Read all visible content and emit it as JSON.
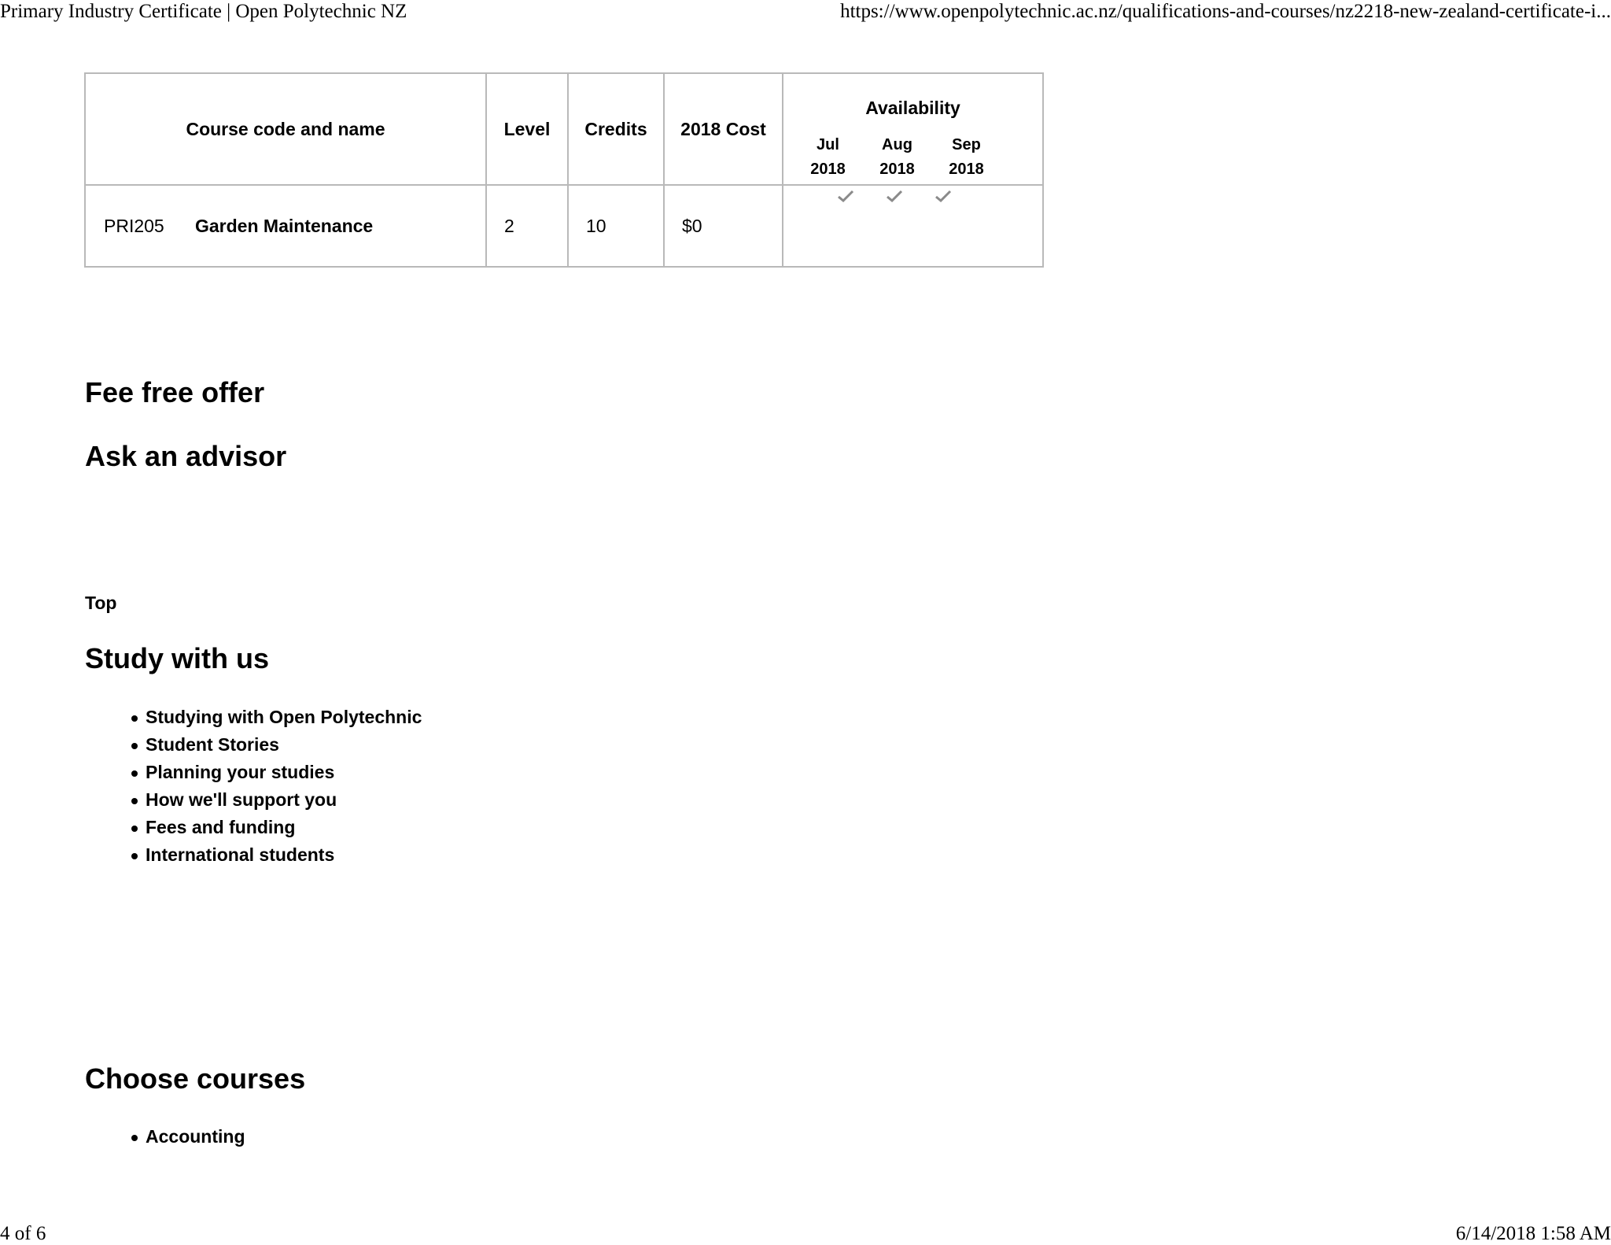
{
  "print_header": {
    "title": "Primary Industry Certificate | Open Polytechnic NZ",
    "url": "https://www.openpolytechnic.ac.nz/qualifications-and-courses/nz2218-new-zealand-certificate-i..."
  },
  "course_table": {
    "headers": {
      "name": "Course code and name",
      "level": "Level",
      "credits": "Credits",
      "cost": "2018 Cost",
      "availability": "Availability"
    },
    "months": [
      {
        "month": "Jul",
        "year": "2018"
      },
      {
        "month": "Aug",
        "year": "2018"
      },
      {
        "month": "Sep",
        "year": "2018"
      }
    ],
    "rows": [
      {
        "code": "PRI205",
        "name": "Garden Maintenance",
        "level": "2",
        "credits": "10",
        "cost": "$0",
        "available": [
          true,
          true,
          true
        ]
      }
    ]
  },
  "sections": {
    "fee_free": "Fee free offer",
    "ask_advisor": "Ask an advisor",
    "top": "Top",
    "study_with_us": "Study with us",
    "choose_courses": "Choose courses"
  },
  "study_links": [
    "Studying with Open Polytechnic",
    "Student Stories",
    "Planning your studies",
    "How we'll support you",
    "Fees and funding",
    "International students"
  ],
  "course_links": [
    "Accounting"
  ],
  "print_footer": {
    "page": "4 of 6",
    "datetime": "6/14/2018 1:58 AM"
  },
  "colors": {
    "border": "#b9b9b9",
    "tick": "#8a8a8a"
  },
  "icons": {
    "available": "checkmark-icon",
    "bullet": "bullet-dot"
  }
}
